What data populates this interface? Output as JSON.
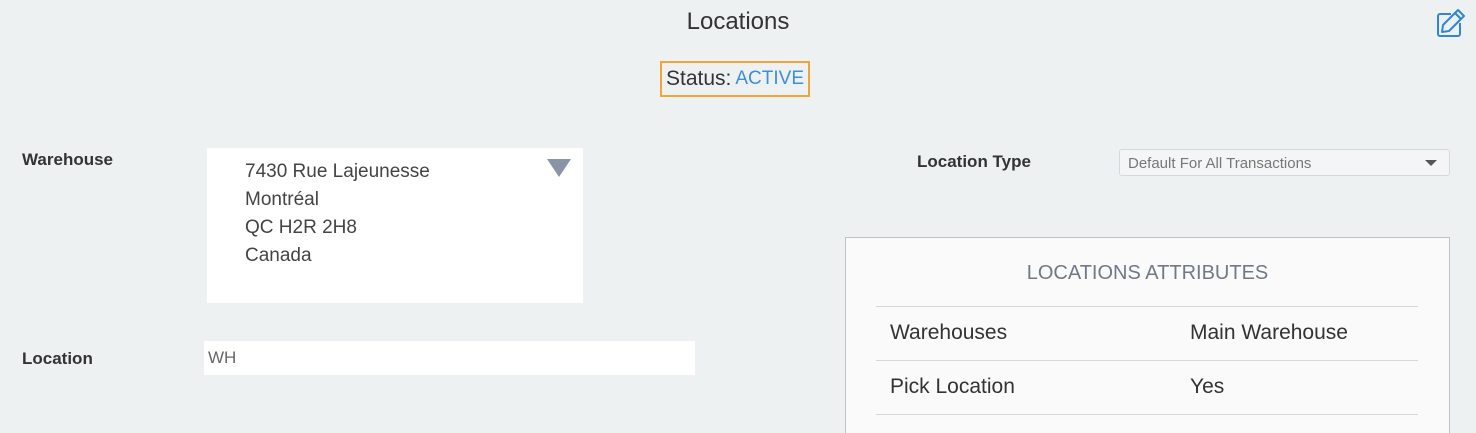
{
  "page": {
    "title": "Locations"
  },
  "status": {
    "label": "Status:",
    "value": "ACTIVE"
  },
  "warehouse": {
    "label": "Warehouse",
    "address_lines": [
      "7430 Rue Lajeunesse",
      "Montréal",
      "QC H2R 2H8",
      "Canada"
    ]
  },
  "location": {
    "label": "Location",
    "value": "WH"
  },
  "location_type": {
    "label": "Location Type",
    "selected": "Default For All Transactions"
  },
  "attributes": {
    "title": "LOCATIONS ATTRIBUTES",
    "rows": [
      {
        "name": "Warehouses",
        "value": "Main Warehouse"
      },
      {
        "name": "Pick Location",
        "value": "Yes"
      }
    ]
  },
  "icons": {
    "edit": "edit-pencil-icon",
    "warehouse_dropdown": "triangle-down-icon",
    "type_dropdown": "caret-down-icon"
  },
  "colors": {
    "background": "#eef1f2",
    "status_border": "#f0a43a",
    "status_active": "#3d8fd6",
    "edit_icon": "#2f86d6"
  }
}
